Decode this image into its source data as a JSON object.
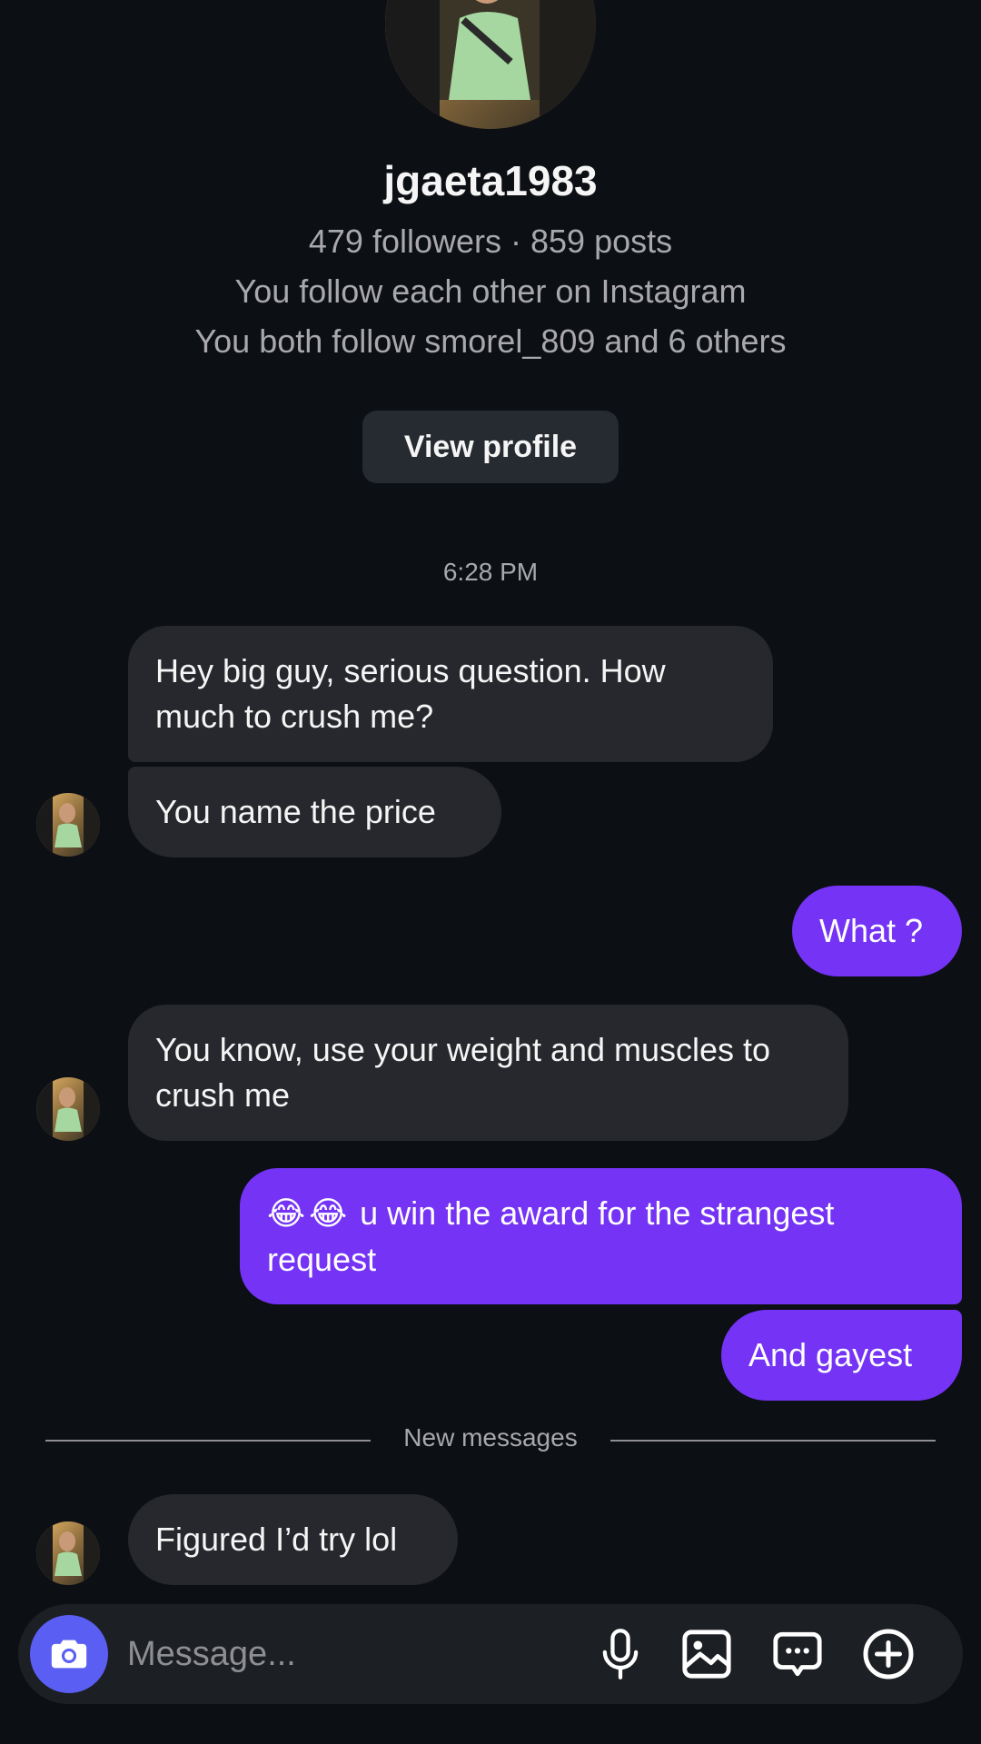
{
  "profile": {
    "username": "jgaeta1983",
    "stats": "479 followers · 859 posts",
    "mutual_follow": "You follow each other on Instagram",
    "mutual_friends": "You both follow smorel_809 and 6 others",
    "view_profile_label": "View profile"
  },
  "chat": {
    "timestamp": "6:28 PM",
    "messages": [
      {
        "from": "them",
        "text": "Hey big guy, serious question. How much to crush me?"
      },
      {
        "from": "them",
        "text": "You name the price"
      },
      {
        "from": "me",
        "text": "What ?"
      },
      {
        "from": "them",
        "text": "You know, use your weight and muscles to crush me"
      },
      {
        "from": "me",
        "emoji": "😂😂",
        "text": "u win the award for the strangest request"
      },
      {
        "from": "me",
        "text": "And gayest"
      },
      {
        "from": "them",
        "text": "Figured I’d try lol"
      }
    ],
    "new_messages_label": "New messages"
  },
  "composer": {
    "placeholder": "Message...",
    "icons": [
      "camera-icon",
      "microphone-icon",
      "gallery-icon",
      "sticker-chat-icon",
      "add-icon"
    ]
  },
  "colors": {
    "background": "#0c0f14",
    "incoming_bubble": "#26282d",
    "outgoing_bubble": "#7433f5",
    "camera_button": "#5b5ef2",
    "secondary_text": "#a8a8ad"
  }
}
